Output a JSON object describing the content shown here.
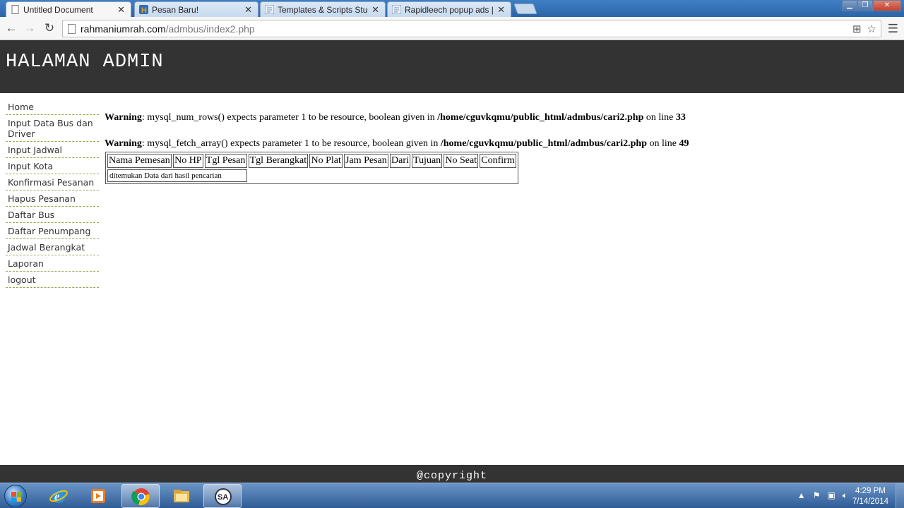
{
  "browser": {
    "tabs": [
      {
        "title": "Untitled Document",
        "active": true
      },
      {
        "title": "Pesan Baru!",
        "active": false
      },
      {
        "title": "Templates & Scripts Stuff",
        "active": false
      },
      {
        "title": "Rapidleech popup ads | Ka",
        "active": false
      }
    ],
    "url_host": "rahmaniumrah.com",
    "url_path": "/admbus/index2.php"
  },
  "page": {
    "header_title": "HALAMAN ADMIN",
    "nav_items": [
      "Home",
      "Input Data Bus dan Driver",
      "Input Jadwal",
      "Input Kota",
      "Konfirmasi Pesanan",
      "Hapus Pesanan",
      "Daftar Bus",
      "Daftar Penumpang",
      "Jadwal Berangkat",
      "Laporan",
      "logout"
    ],
    "warnings": [
      {
        "label": "Warning",
        "message": ": mysql_num_rows() expects parameter 1 to be resource, boolean given in ",
        "path": "/home/cguvkqmu/public_html/admbus/cari2.php",
        "line_text": " on line ",
        "line": "33"
      },
      {
        "label": "Warning",
        "message": ": mysql_fetch_array() expects parameter 1 to be resource, boolean given in ",
        "path": "/home/cguvkqmu/public_html/admbus/cari2.php",
        "line_text": " on line ",
        "line": "49"
      }
    ],
    "table": {
      "headers": [
        "Nama Pemesan",
        "No HP",
        "Tgl Pesan",
        "Tgl Berangkat",
        "No Plat",
        "Jam Pesan",
        "Dari",
        "Tujuan",
        "No Seat",
        "Confirm"
      ],
      "empty_message": "ditemukan Data dari hasil pencarian"
    },
    "footer": "@copyright"
  },
  "taskbar": {
    "time": "4:29 PM",
    "date": "7/14/2014"
  },
  "colors": {
    "header_bg": "#333333",
    "nav_border": "#9aa84f",
    "taskbar": "#2f5c96"
  }
}
